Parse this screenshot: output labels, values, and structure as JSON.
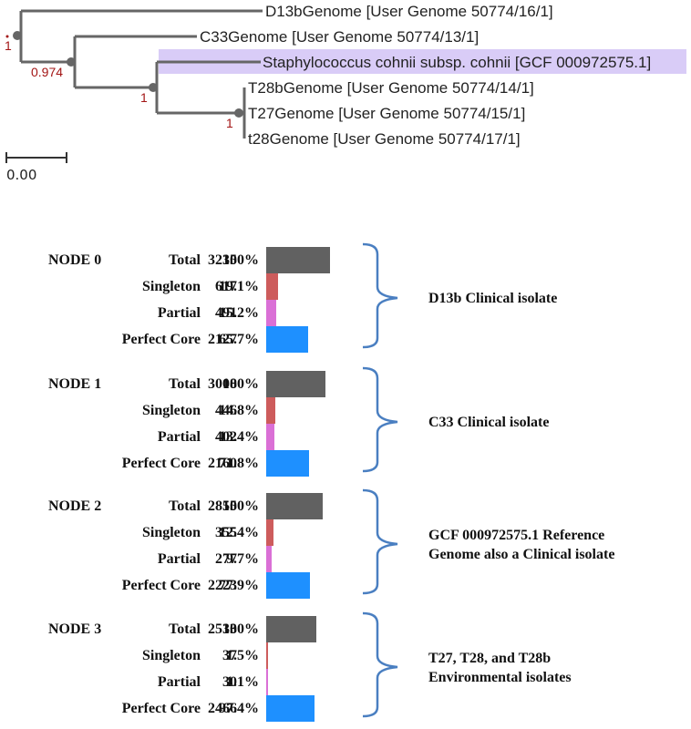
{
  "tree": {
    "leaves": [
      {
        "name": "D13bGenome [User Genome 50774/16/1]",
        "highlighted": false
      },
      {
        "name": "C33Genome [User Genome 50774/13/1]",
        "highlighted": false
      },
      {
        "name": "Staphylococcus cohnii subsp. cohnii [GCF 000972575.1]",
        "highlighted": true
      },
      {
        "name": "T28bGenome [User Genome 50774/14/1]",
        "highlighted": false
      },
      {
        "name": "T27Genome [User Genome 50774/15/1]",
        "highlighted": false
      },
      {
        "name": "t28Genome [User Genome 50774/17/1]",
        "highlighted": false
      }
    ],
    "support_values": [
      "1",
      "0.974",
      "1",
      "1"
    ],
    "scale_bar_label": "0.00",
    "highlight_color": "#d9ccf7",
    "branch_color": "#666666",
    "support_color": "#a31515"
  },
  "chart_data": {
    "type": "bar",
    "title": "",
    "categories": [
      "Total",
      "Singleton",
      "Partial",
      "Perfect Core"
    ],
    "colors": {
      "Total": "#616161",
      "Singleton": "#cd5c5c",
      "Partial": "#da70d6",
      "Perfect Core": "#1e90ff"
    },
    "bracket_color": "#4a7fc1",
    "nodes": [
      {
        "node": "NODE 0",
        "annotation": [
          "D13b Clinical isolate"
        ],
        "rows": [
          {
            "label": "Total",
            "count": "3235",
            "percent": "100%",
            "value": 3235
          },
          {
            "label": "Singleton",
            "count": "617",
            "percent": "19.1%",
            "value": 617
          },
          {
            "label": "Partial",
            "count": "491",
            "percent": "15.2%",
            "value": 491
          },
          {
            "label": "Perfect Core",
            "count": "2127",
            "percent": "65.7%",
            "value": 2127
          }
        ]
      },
      {
        "node": "NODE 1",
        "annotation": [
          "C33 Clinical isolate"
        ],
        "rows": [
          {
            "label": "Total",
            "count": "3008",
            "percent": "100%",
            "value": 3008
          },
          {
            "label": "Singleton",
            "count": "446",
            "percent": "14.8%",
            "value": 446
          },
          {
            "label": "Partial",
            "count": "402",
            "percent": "13.4%",
            "value": 402
          },
          {
            "label": "Perfect Core",
            "count": "2160",
            "percent": "71.8%",
            "value": 2160
          }
        ]
      },
      {
        "node": "NODE 2",
        "annotation": [
          "GCF 000972575.1 Reference",
          "Genome also a Clinical isolate"
        ],
        "rows": [
          {
            "label": "Total",
            "count": "2855",
            "percent": "100%",
            "value": 2855
          },
          {
            "label": "Singleton",
            "count": "355",
            "percent": "12.4%",
            "value": 355
          },
          {
            "label": "Partial",
            "count": "277",
            "percent": "9.7%",
            "value": 277
          },
          {
            "label": "Perfect Core",
            "count": "2223",
            "percent": "77.9%",
            "value": 2223
          }
        ]
      },
      {
        "node": "NODE 3",
        "annotation": [
          "T27, T28, and T28b",
          "Environmental isolates"
        ],
        "rows": [
          {
            "label": "Total",
            "count": "2533",
            "percent": "100%",
            "value": 2533
          },
          {
            "label": "Singleton",
            "count": "37",
            "percent": "1.5%",
            "value": 37
          },
          {
            "label": "Partial",
            "count": "30",
            "percent": "1.1%",
            "value": 30
          },
          {
            "label": "Perfect Core",
            "count": "2466",
            "percent": "97.4%",
            "value": 2466
          }
        ]
      }
    ],
    "xlim": [
      0,
      3235
    ]
  }
}
